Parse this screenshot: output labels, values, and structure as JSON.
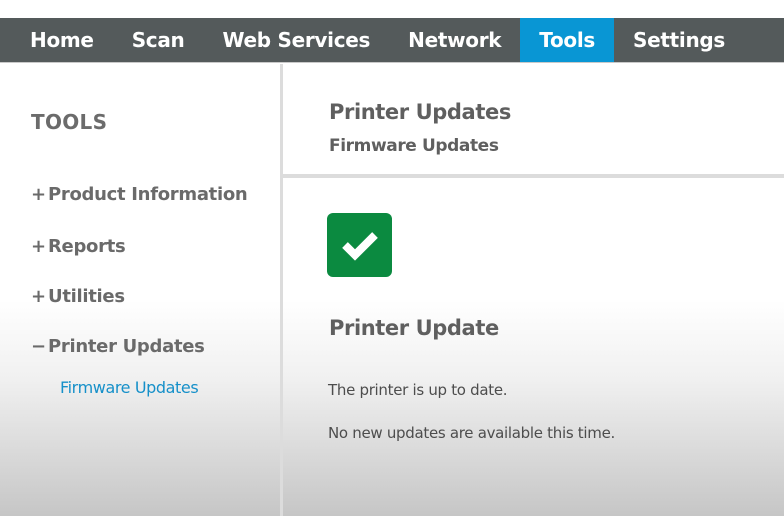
{
  "nav": {
    "items": [
      {
        "label": "Home",
        "active": false
      },
      {
        "label": "Scan",
        "active": false
      },
      {
        "label": "Web Services",
        "active": false
      },
      {
        "label": "Network",
        "active": false
      },
      {
        "label": "Tools",
        "active": true
      },
      {
        "label": "Settings",
        "active": false
      }
    ],
    "colors": {
      "bar": "#545a5b",
      "active": "#0996d4"
    }
  },
  "sidebar": {
    "title": "TOOLS",
    "items": [
      {
        "sign": "+",
        "label": "Product Information",
        "expanded": false
      },
      {
        "sign": "+",
        "label": "Reports",
        "expanded": false
      },
      {
        "sign": "+",
        "label": "Utilities",
        "expanded": false
      },
      {
        "sign": "−",
        "label": "Printer Updates",
        "expanded": true
      }
    ],
    "sub_items": [
      {
        "label": "Firmware Updates",
        "selected": true
      }
    ],
    "link_color": "#1690c9"
  },
  "main": {
    "title": "Printer Updates",
    "subtitle": "Firmware Updates",
    "status_icon": "checkmark-icon",
    "status_color": "#0b8a40",
    "section_title": "Printer Update",
    "messages": [
      "The printer is up to date.",
      "No new updates are available this time."
    ]
  }
}
